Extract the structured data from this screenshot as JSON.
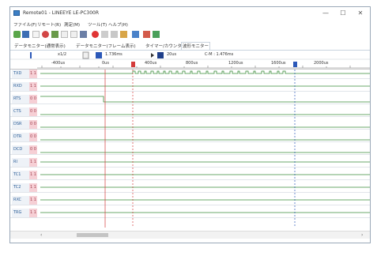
{
  "window": {
    "title": "Remote01 - LINEEYE LE-PC300R",
    "minimize": "—",
    "maximize": "☐",
    "close": "✕"
  },
  "menu": [
    "ファイル(F)",
    "リモート(R)",
    "測定(M)",
    "ツール(T)",
    "ヘルプ(H)"
  ],
  "tabs": [
    {
      "label": "データモニター(通常表示)",
      "active": false
    },
    {
      "label": "データモニター(フレーム表示)",
      "active": false
    },
    {
      "label": "タイマー/カウンタ",
      "active": false
    },
    {
      "label": "波形モニター",
      "active": true
    }
  ],
  "controls": {
    "zoom": "x1/2",
    "cursor_a": "1.736ms",
    "cursor_b": "20us",
    "delta": "C-M : 1.476ms"
  },
  "ruler_labels": [
    "-400us",
    "0us",
    "400us",
    "800us",
    "1200us",
    "1600us",
    "2000us"
  ],
  "signals": [
    {
      "name": "TXD",
      "value": "1 1"
    },
    {
      "name": "RXD",
      "value": "1 1"
    },
    {
      "name": "RTS",
      "value": "0 0"
    },
    {
      "name": "CTS",
      "value": "0 0"
    },
    {
      "name": "DSR",
      "value": "0 0"
    },
    {
      "name": "DTR",
      "value": "0 0"
    },
    {
      "name": "DCD",
      "value": "0 0"
    },
    {
      "name": "RI",
      "value": "1 1"
    },
    {
      "name": "TC1",
      "value": "1 1"
    },
    {
      "name": "TC2",
      "value": "1 1"
    },
    {
      "name": "RXC",
      "value": "1 1"
    },
    {
      "name": "TRG",
      "value": "1 1"
    }
  ],
  "scroll": {
    "left": "‹",
    "right": "›"
  },
  "colors": {
    "marker_red": "#d43a3a",
    "marker_blue": "#2b58b8",
    "wave": "#3a8c3a",
    "name_text": "#2a5d97",
    "value_bg": "#f6cfd5"
  }
}
